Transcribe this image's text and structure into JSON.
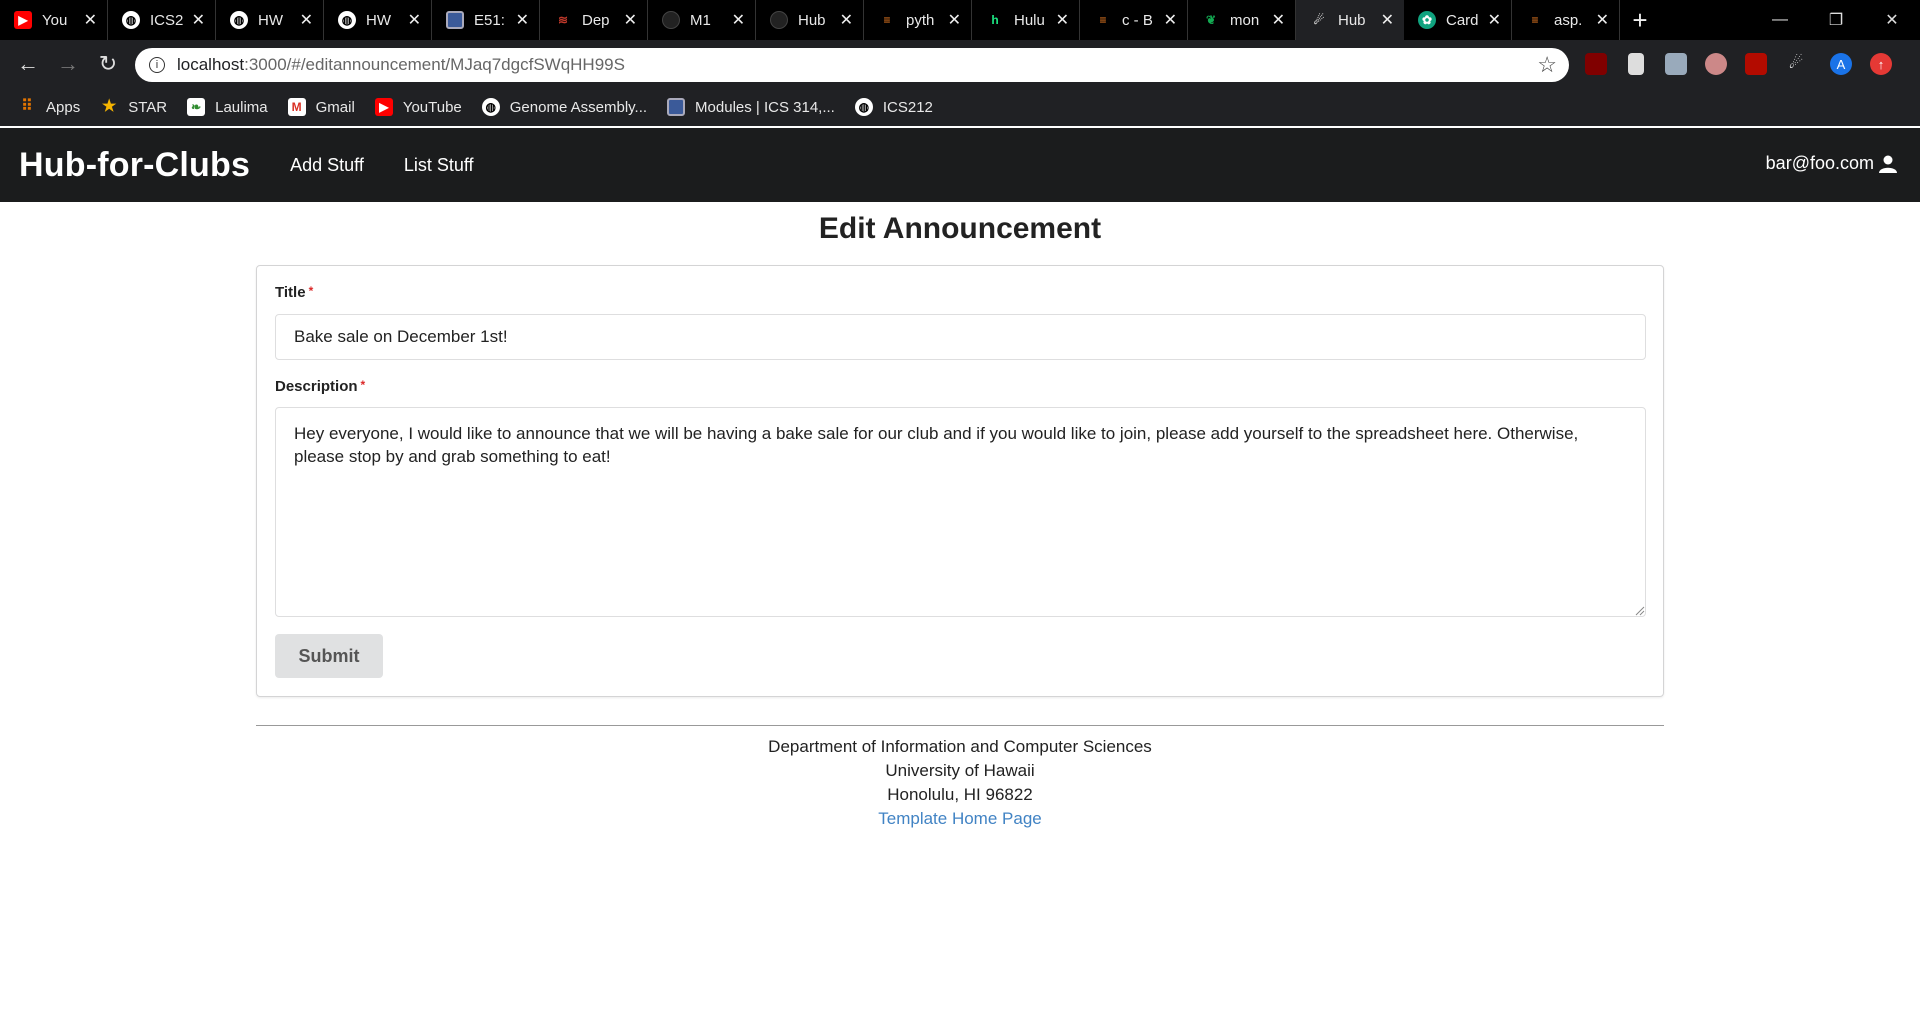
{
  "browser": {
    "tabs": [
      {
        "label": "You",
        "icon": "youtube-icon",
        "color": "#ff0000"
      },
      {
        "label": "ICS2",
        "icon": "globe-icon",
        "color": "#ffffff"
      },
      {
        "label": "HW",
        "icon": "globe-icon",
        "color": "#ffffff"
      },
      {
        "label": "HW",
        "icon": "globe-icon",
        "color": "#ffffff"
      },
      {
        "label": "E51:",
        "icon": "square-icon",
        "color": "#3b5a99"
      },
      {
        "label": "Dep",
        "icon": "deploy-icon",
        "color": "#c0392b"
      },
      {
        "label": "M1",
        "icon": "github-icon",
        "color": "#333333"
      },
      {
        "label": "Hub",
        "icon": "github-icon",
        "color": "#333333"
      },
      {
        "label": "pyth",
        "icon": "stackoverflow-icon",
        "color": "#f48024"
      },
      {
        "label": "Hulu",
        "icon": "hulu-icon",
        "color": "#1ce783"
      },
      {
        "label": "c - B",
        "icon": "stackoverflow-icon",
        "color": "#f48024"
      },
      {
        "label": "mon",
        "icon": "mongodb-icon",
        "color": "#13aa52"
      },
      {
        "label": "Hub",
        "icon": "meteor-icon",
        "color": "#cccccc",
        "active": true
      },
      {
        "label": "Card",
        "icon": "openai-icon",
        "color": "#10a37f"
      },
      {
        "label": "asp.",
        "icon": "stackoverflow-icon",
        "color": "#f48024"
      }
    ],
    "url_host": "localhost",
    "url_rest": ":3000/#/editannouncement/MJaq7dgcfSWqHH99S",
    "bookmarks": [
      {
        "label": "Apps",
        "icon": "apps-grid-icon"
      },
      {
        "label": "STAR",
        "icon": "star-logo-icon"
      },
      {
        "label": "Laulima",
        "icon": "laulima-icon"
      },
      {
        "label": "Gmail",
        "icon": "gmail-icon"
      },
      {
        "label": "YouTube",
        "icon": "youtube-icon"
      },
      {
        "label": "Genome Assembly...",
        "icon": "globe-icon"
      },
      {
        "label": "Modules | ICS 314,...",
        "icon": "square-icon"
      },
      {
        "label": "ICS212",
        "icon": "globe-icon"
      }
    ],
    "profile_initial": "A"
  },
  "navbar": {
    "brand": "Hub-for-Clubs",
    "links": [
      "Add Stuff",
      "List Stuff"
    ],
    "user": "bar@foo.com"
  },
  "form": {
    "heading": "Edit Announcement",
    "title_label": "Title",
    "title_value": "Bake sale on December 1st!",
    "description_label": "Description",
    "description_value": "Hey everyone, I would like to announce that we will be having a bake sale for our club and if you would like to join, please add yourself to the spreadsheet here. Otherwise, please stop by and grab something to eat!",
    "required_mark": "*",
    "submit_label": "Submit"
  },
  "footer": {
    "line1": "Department of Information and Computer Sciences",
    "line2": "University of Hawaii",
    "line3": "Honolulu, HI 96822",
    "link": "Template Home Page"
  }
}
